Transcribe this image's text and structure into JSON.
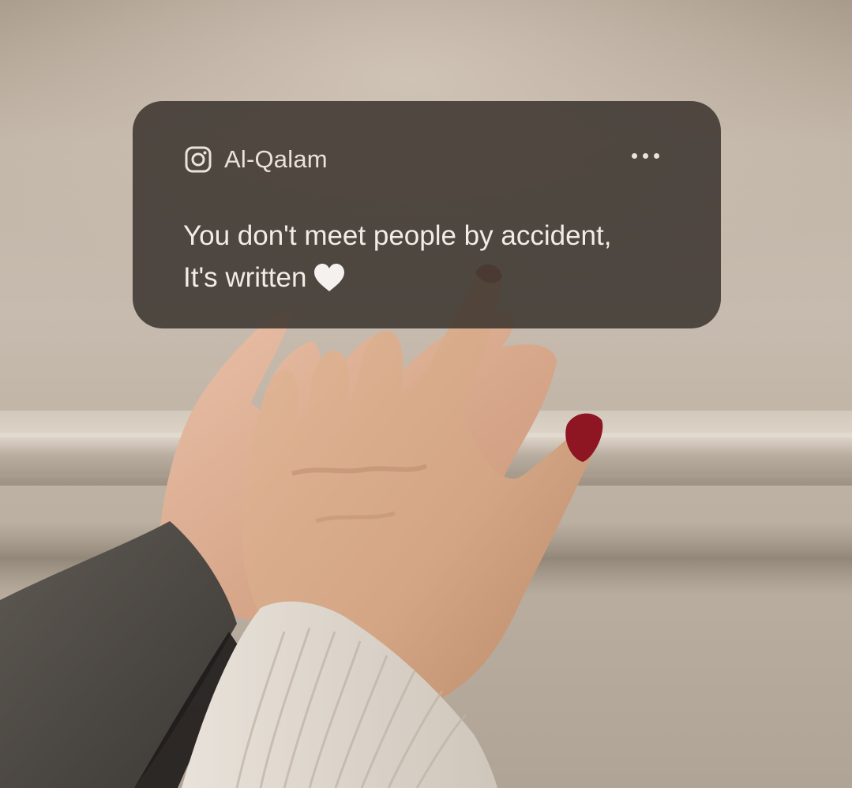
{
  "post_card": {
    "account_icon": "instagram-icon",
    "account_name": "Al-Qalam",
    "more_icon": "more-horizontal-icon",
    "quote_line_1": "You don't meet people by accident,",
    "quote_line_2": "It's written",
    "quote_icon": "white-heart-icon"
  },
  "colors": {
    "card_background": "#3a332d",
    "card_text": "#f1ece6",
    "wall": "#c2b6a8",
    "nail_polish": "#8e1522"
  }
}
